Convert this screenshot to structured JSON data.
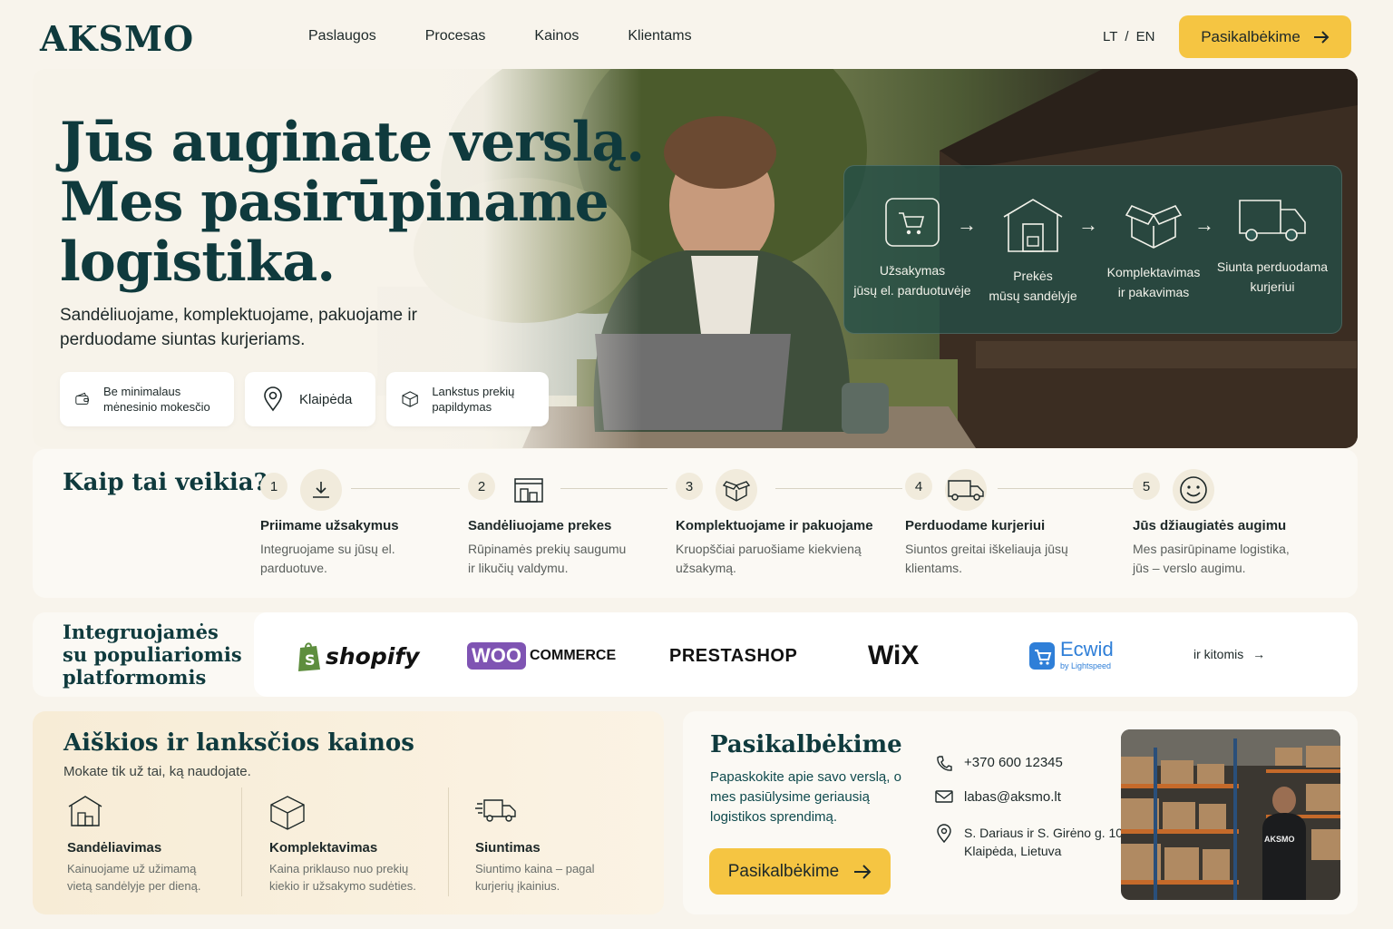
{
  "nav": {
    "logo": "AKSMO",
    "items": [
      "Paslaugos",
      "Procesas",
      "Kainos",
      "Klientams"
    ],
    "lang_lt": "LT",
    "lang_sep": "/",
    "lang_en": "EN",
    "cta": "Pasikalbėkime"
  },
  "hero": {
    "title_line1": "Jūs auginate verslą.",
    "title_line2": "Mes pasirūpiname",
    "title_line3": "logistika.",
    "subtitle": "Sandėliuojame, komplektuojame, pakuojame ir perduodame siuntas kurjeriams.",
    "chips": [
      {
        "icon": "wallet-icon",
        "text": "Be minimalaus mėnesinio mokesčio"
      },
      {
        "icon": "location-pin-icon",
        "text": "Klaipėda"
      },
      {
        "icon": "box-icon",
        "text": "Lankstus prekių papildymas"
      }
    ],
    "flow": [
      {
        "icon": "cart-icon",
        "line1": "Užsakymas",
        "line2": "jūsų el. parduotuvėje"
      },
      {
        "icon": "warehouse-icon",
        "line1": "Prekės",
        "line2": "mūsų sandėlyje"
      },
      {
        "icon": "open-box-icon",
        "line1": "Komplektavimas",
        "line2": "ir pakavimas"
      },
      {
        "icon": "truck-icon",
        "line1": "Siunta perduodama",
        "line2": "kurjeriui"
      }
    ],
    "flow_arrow": "→"
  },
  "how": {
    "title": "Kaip tai veikia?",
    "steps": [
      {
        "num": "1",
        "icon": "download-icon",
        "title": "Priimame užsakymus",
        "text": "Integruojame su jūsų el. parduotuve."
      },
      {
        "num": "2",
        "icon": "warehouse-icon",
        "title": "Sandėliuojame prekes",
        "text": "Rūpinamės prekių saugumu ir likučių valdymu."
      },
      {
        "num": "3",
        "icon": "open-box-icon",
        "title": "Komplektuojame ir pakuojame",
        "text": "Kruopščiai paruošiame kiekvieną užsakymą."
      },
      {
        "num": "4",
        "icon": "truck-icon",
        "title": "Perduodame kurjeriui",
        "text": "Siuntos greitai iškeliauja jūsų klientams."
      },
      {
        "num": "5",
        "icon": "smile-icon",
        "title": "Jūs džiaugiatės augimu",
        "text": "Mes pasirūpiname logistika, jūs – verslo augimu."
      }
    ]
  },
  "integrations": {
    "title_line1": "Integruojamės",
    "title_line2": "su populiariomis",
    "title_line3": "platformomis",
    "logos": {
      "shopify": "shopify",
      "woo": "WOO",
      "commerce": "COMMERCE",
      "prestashop": "PRESTASHOP",
      "wix": "WiX",
      "ecwid": "Ecwid",
      "ecwid_sub": "by Lightspeed"
    },
    "more": "ir kitomis"
  },
  "prices": {
    "title": "Aiškios ir lanksčios kainos",
    "subtitle": "Mokate tik už tai, ką naudojate.",
    "cols": [
      {
        "icon": "warehouse-icon",
        "title": "Sandėliavimas",
        "text": "Kainuojame už užimamą vietą sandėlyje per dieną."
      },
      {
        "icon": "box-icon",
        "title": "Komplektavimas",
        "text": "Kaina priklauso nuo prekių kiekio ir užsakymo sudėties."
      },
      {
        "icon": "fast-truck-icon",
        "title": "Siuntimas",
        "text": "Siuntimo kaina – pagal kurjerių įkainius."
      }
    ]
  },
  "contact": {
    "title": "Pasikalbėkime",
    "text": "Papaskokite apie savo verslą, o mes pasiūlysime geriausią logistikos sprendimą.",
    "button": "Pasikalbėkime",
    "phone": "+370 600 12345",
    "email": "labas@aksmo.lt",
    "address_line1": "S. Dariaus ir S. Girėno g. 10",
    "address_line2": "Klaipėda, Lietuva",
    "jacket_text": "AKSMO"
  },
  "colors": {
    "primary": "#0f3a3d",
    "accent": "#f5c542",
    "background": "#f8f4ec"
  }
}
